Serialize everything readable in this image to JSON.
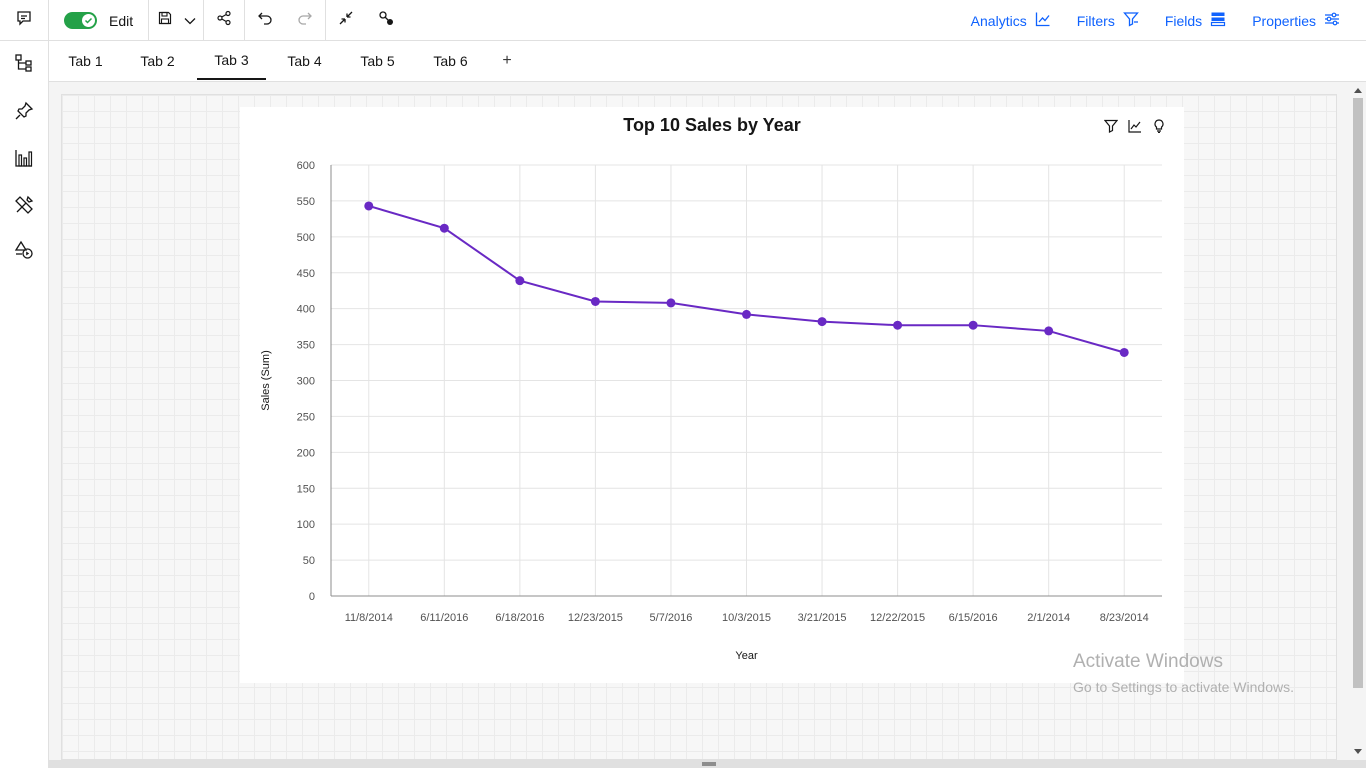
{
  "toolbar": {
    "edit_label": "Edit",
    "actions": [
      {
        "label": "Analytics",
        "icon": "analytics-icon"
      },
      {
        "label": "Filters",
        "icon": "filter-icon"
      },
      {
        "label": "Fields",
        "icon": "fields-icon"
      },
      {
        "label": "Properties",
        "icon": "properties-icon"
      }
    ],
    "toggle_color": "#24a148",
    "accent": "#0f62fe"
  },
  "tabs": [
    {
      "label": "Tab 1",
      "active": false
    },
    {
      "label": "Tab 2",
      "active": false
    },
    {
      "label": "Tab 3",
      "active": true
    },
    {
      "label": "Tab 4",
      "active": false
    },
    {
      "label": "Tab 5",
      "active": false
    },
    {
      "label": "Tab 6",
      "active": false
    }
  ],
  "tab_add_label": "+",
  "watermark": {
    "title": "Activate Windows",
    "subtitle": "Go to Settings to activate Windows."
  },
  "chart_data": {
    "type": "line",
    "title": "Top 10 Sales by Year",
    "xlabel": "Year",
    "ylabel": "Sales (Sum)",
    "categories": [
      "11/8/2014",
      "6/11/2016",
      "6/18/2016",
      "12/23/2015",
      "5/7/2016",
      "10/3/2015",
      "3/21/2015",
      "12/22/2015",
      "6/15/2016",
      "2/1/2014",
      "8/23/2014"
    ],
    "series": [
      {
        "values": [
          543,
          512,
          439,
          410,
          408,
          392,
          382,
          377,
          377,
          369,
          339
        ],
        "color": "#6929c4"
      }
    ],
    "ylim": [
      0,
      600
    ],
    "yticks": [
      0,
      50,
      100,
      150,
      200,
      250,
      300,
      350,
      400,
      450,
      500,
      550,
      600
    ],
    "grid": true
  }
}
